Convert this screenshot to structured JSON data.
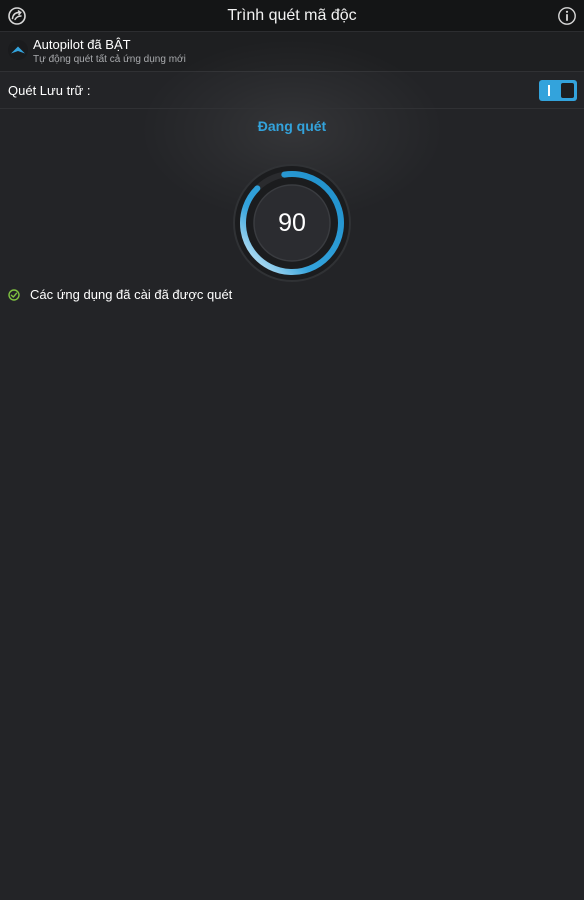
{
  "header": {
    "title": "Trình quét mã độc",
    "left_icon": "app-logo-icon",
    "right_icon": "info-icon"
  },
  "autopilot": {
    "title": "Autopilot đã BẬT",
    "subtitle": "Tự động quét tất cả ứng dụng mới",
    "icon": "autopilot-arrow-icon"
  },
  "storage_scan": {
    "label": "Quét Lưu trữ :",
    "toggle_state": "on",
    "toggle_on_symbol": "I"
  },
  "scan": {
    "status": "Đang quét",
    "progress_value": "90",
    "progress_fraction": 0.9
  },
  "results": [
    {
      "text": "Các ứng dụng đã cài đã được quét",
      "icon": "check-circle-icon"
    }
  ],
  "colors": {
    "accent": "#33a3dc",
    "background": "#232427",
    "topbar": "#141516",
    "check": "#7fc241"
  }
}
